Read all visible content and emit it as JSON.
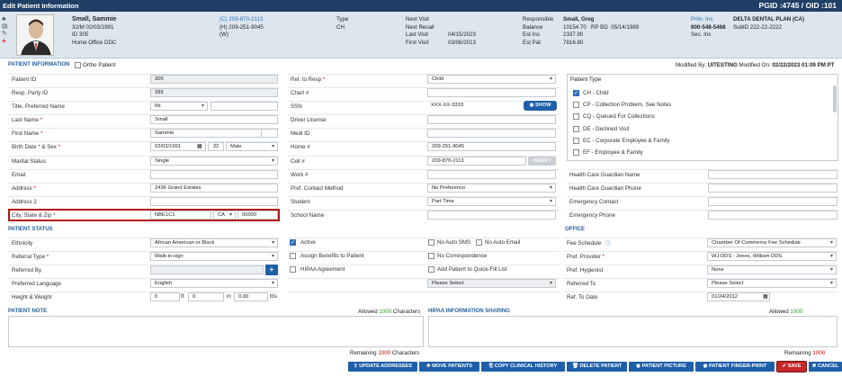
{
  "title": "Edit Patient Information",
  "ids": "PGID :4745 / OID :101",
  "header": {
    "name": "Small, Sammie",
    "line2": "32/M  02/03/1991",
    "line3": "ID 305",
    "line4": "Home Office  DDC",
    "phoneC": "(C)  209-870-2113",
    "phoneH": "(H)  209-251-9045",
    "phoneW": "(W)",
    "typeLbl": "Type",
    "typeVal": "CH",
    "nv": "Next Visit",
    "nr": "Next Recall",
    "lv": "Last Visit",
    "lvVal": "04/15/2023",
    "fv": "First Visit",
    "fvVal": "03/06/2013",
    "resp": "Responsible",
    "respVal": "Small, Greg",
    "bal": "Balance",
    "balVal": "10154.70",
    "rpbd": "RP BD",
    "rpbdVal": "05/14/1989",
    "estIns": "Est Ins",
    "estInsVal": "2337.90",
    "estPat": "Est Pat",
    "estPatVal": "7816.80",
    "prim": "Prim. Ins",
    "primVal": "DELTA DENTAL PLAN (CA)",
    "insPhone": "800-548-5468",
    "subid": "SubID  222-22-2222",
    "sec": "Sec. Ins"
  },
  "sections": {
    "pi": "PATIENT INFORMATION",
    "ortho": "Ortho Patient",
    "mod": "Modified By:",
    "modBy": "UITESTING",
    "modOn": "Modified On:",
    "modOnVal": "02/22/2023 01:09 PM PT",
    "ps": "PATIENT STATUS",
    "office": "OFFICE",
    "note": "PATIENT NOTE",
    "hipaa": "HIPAA INFORMATION SHARING"
  },
  "left": [
    {
      "l": "Patient ID",
      "v": "305"
    },
    {
      "l": "Resp. Party ID",
      "v": "285"
    },
    {
      "l": "Title, Preferred Name",
      "v": "Mr."
    },
    {
      "l": "Last Name",
      "v": "Small",
      "r": true
    },
    {
      "l": "First Name",
      "v": "Sammie",
      "r": true
    },
    {
      "l": "Birth Date * & Sex",
      "v": "02/03/1991",
      "r": true,
      "age": "32",
      "sex": "Male"
    },
    {
      "l": "Marital Status",
      "v": "Single"
    },
    {
      "l": "Email",
      "v": ""
    },
    {
      "l": "Address",
      "v": "2436 Grand Estates",
      "r": true
    },
    {
      "l": "Address 2",
      "v": ""
    },
    {
      "l": "City, State & Zip",
      "v": "NBE1C1",
      "st": "CA",
      "zip": "00000",
      "r": true
    }
  ],
  "mid": [
    {
      "l": "Rel. to Resp",
      "v": "Child",
      "r": true
    },
    {
      "l": "Chart #",
      "v": ""
    },
    {
      "l": "SSN",
      "v": "XXX-XX-3333"
    },
    {
      "l": "Driver License",
      "v": ""
    },
    {
      "l": "Medi ID",
      "v": ""
    },
    {
      "l": "Home #",
      "v": "209-251-9045"
    },
    {
      "l": "Cell #",
      "v": "209-870-2113"
    },
    {
      "l": "Work #",
      "v": ""
    },
    {
      "l": "Pref. Contact Method",
      "v": "No Preference"
    },
    {
      "l": "Student",
      "v": "Part Time"
    },
    {
      "l": "School Name",
      "v": ""
    }
  ],
  "show": "SHOW",
  "verify": "VERIFY",
  "ptype": {
    "title": "Patient Type",
    "items": [
      "CH - Child",
      "CP - Collection Problem, See Notes",
      "CQ - Queued For Collections",
      "DE - Declined Visit",
      "EC - Corporate Employee & Family",
      "EF - Employee & Family"
    ]
  },
  "guardian": [
    "Health Care Guardian Name",
    "Health Care Guardian Phone",
    "Emergency Contact",
    "Emergency Phone"
  ],
  "status": [
    {
      "l": "Ethnicity",
      "v": "African American or Black"
    },
    {
      "l": "Referral Type",
      "v": "Walk-in-sign",
      "r": true
    },
    {
      "l": "Referred By",
      "v": ""
    },
    {
      "l": "Preferred Language",
      "v": "English"
    },
    {
      "l": "Height & Weight",
      "v": "0",
      "ft": "ft",
      "in": "0",
      "inl": "in",
      "w": "0.00",
      "wl": "lbs"
    }
  ],
  "checks": {
    "active": "Active",
    "assign": "Assign Benefits to Patient",
    "hipaa": "HIPAA Agreement",
    "noSms": "No Auto SMS",
    "noEmail": "No Auto Email",
    "noCorr": "No Correspondence",
    "quick": "Add Patient to Quick-Fill List",
    "pleaseSel": "Please Select"
  },
  "office": [
    {
      "l": "Fee Schedule",
      "v": "Chamber Of Commerce Fee Schedule"
    },
    {
      "l": "Pref. Provider",
      "v": "WJ DDS : Jones, William DDS",
      "r": true
    },
    {
      "l": "Pref. Hygienist",
      "v": "None"
    },
    {
      "l": "Referred To",
      "v": "Please Select"
    },
    {
      "l": "Ref. To Date",
      "v": "01/24/2012"
    }
  ],
  "allowed1": "Allowed",
  "allowedN": "1000",
  "allowed2": "Characters",
  "remaining1": "Remaining",
  "remainingN": "1000",
  "remaining2": "Characters",
  "buttons": [
    "UPDATE ADDRESSES",
    "MOVE PATIENTS",
    "COPY CLINICAL HISTORY",
    "DELETE PATIENT",
    "PATIENT PICTURE",
    "PATIENT FINGER-PRINT",
    "SAVE",
    "CANCEL"
  ]
}
